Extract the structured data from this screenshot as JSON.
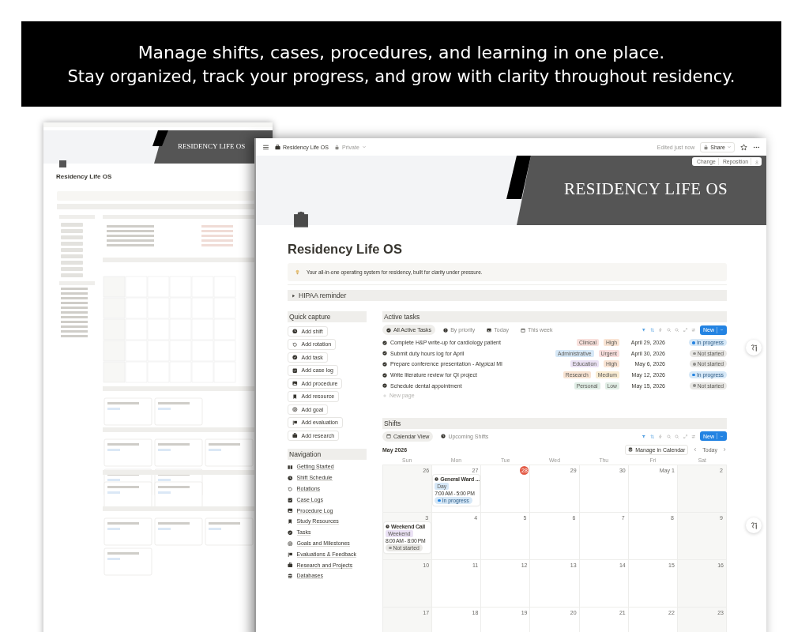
{
  "banner": {
    "lines": [
      "Manage shifts, cases, procedures, and learning in one place.",
      "Stay organized, track your progress, and grow with clarity throughout residency."
    ]
  },
  "back_window": {
    "cover_title": "RESIDENCY LIFE OS",
    "page_title": "Residency Life OS"
  },
  "window": {
    "page_name": "Residency Life OS",
    "privacy": "Private",
    "edited": "Edited just now",
    "share": "Share"
  },
  "cover": {
    "title": "RESIDENCY LIFE OS",
    "buttons": [
      "Change",
      "Reposition"
    ]
  },
  "page": {
    "title": "Residency Life OS",
    "callout": "Your all-in-one operating system for residency, built for clarity under pressure."
  },
  "toggle": {
    "label": "HIPAA reminder",
    "expanded": false
  },
  "quick_capture": {
    "title": "Quick capture",
    "buttons": [
      "Add shift",
      "Add rotation",
      "Add task",
      "Add case log",
      "Add procedure",
      "Add resource",
      "Add goal",
      "Add evaluation",
      "Add research"
    ]
  },
  "navigation": {
    "title": "Navigation",
    "items": [
      "Getting Started",
      "Shift Schedule",
      "Rotations",
      "Case Logs",
      "Procedure Log",
      "Study Resources",
      "Tasks",
      "Goals and Milestones",
      "Evaluations & Feedback",
      "Research and Projects",
      "Databases"
    ]
  },
  "active_tasks": {
    "title": "Active tasks",
    "views": [
      {
        "label": "All Active Tasks",
        "selected": true
      },
      {
        "label": "By priority",
        "selected": false
      },
      {
        "label": "Today",
        "selected": false
      },
      {
        "label": "This week",
        "selected": false
      }
    ],
    "new_button": "New",
    "rows": [
      {
        "title": "Complete H&P write-up for cardiology patient",
        "tags": [
          {
            "label": "Clinical",
            "color": "#f8e0dc"
          },
          {
            "label": "High",
            "color": "#f9e4d4"
          }
        ],
        "date": "April 29, 2026",
        "status": {
          "label": "In progress",
          "kind": "in_progress"
        }
      },
      {
        "title": "Submit duty hours log for April",
        "tags": [
          {
            "label": "Administrative",
            "color": "#d6e8f7"
          },
          {
            "label": "Urgent",
            "color": "#f9dede"
          }
        ],
        "date": "April 30, 2026",
        "status": {
          "label": "Not started",
          "kind": "not_started"
        }
      },
      {
        "title": "Prepare conference presentation - Atypical MI",
        "tags": [
          {
            "label": "Education",
            "color": "#ebe2f5"
          },
          {
            "label": "High",
            "color": "#f9e4d4"
          }
        ],
        "date": "May 6, 2026",
        "status": {
          "label": "Not started",
          "kind": "not_started"
        }
      },
      {
        "title": "Write literature review for QI project",
        "tags": [
          {
            "label": "Research",
            "color": "#f8e3d2"
          },
          {
            "label": "Medium",
            "color": "#f9ecd2"
          }
        ],
        "date": "May 12, 2026",
        "status": {
          "label": "In progress",
          "kind": "in_progress"
        }
      },
      {
        "title": "Schedule dental appointment",
        "tags": [
          {
            "label": "Personal",
            "color": "#dfede5"
          },
          {
            "label": "Low",
            "color": "#e1eee6"
          }
        ],
        "date": "May 15, 2026",
        "status": {
          "label": "Not started",
          "kind": "not_started"
        }
      }
    ],
    "new_page": "New page"
  },
  "shifts": {
    "title": "Shifts",
    "views": [
      {
        "label": "Calendar View",
        "selected": true
      },
      {
        "label": "Upcoming Shifts",
        "selected": false
      }
    ],
    "new_button": "New",
    "month": "May 2026",
    "manage": "Manage in Calendar",
    "today": "Today",
    "weekdays": [
      "Sun",
      "Mon",
      "Tue",
      "Wed",
      "Thu",
      "Fri",
      "Sat"
    ],
    "weeks": [
      {
        "days": [
          {
            "label": "26",
            "today": false
          },
          {
            "label": "27",
            "today": false,
            "event": {
              "title": "General Ward ...",
              "tag": {
                "label": "Day",
                "color": "#d6e8f7"
              },
              "time": "7:00 AM - 5:00 PM",
              "status": {
                "label": "In progress",
                "kind": "in_progress"
              }
            }
          },
          {
            "label": "28",
            "today": true
          },
          {
            "label": "29",
            "today": false
          },
          {
            "label": "30",
            "today": false
          },
          {
            "label": "May 1",
            "today": false
          },
          {
            "label": "2",
            "today": false
          }
        ]
      },
      {
        "days": [
          {
            "label": "3",
            "today": false,
            "event": {
              "title": "Weekend Call",
              "tag": {
                "label": "Weekend",
                "color": "#ebe2f5"
              },
              "time": "8:00 AM - 8:00 PM",
              "status": {
                "label": "Not started",
                "kind": "not_started"
              }
            }
          },
          {
            "label": "4",
            "today": false
          },
          {
            "label": "5",
            "today": false
          },
          {
            "label": "6",
            "today": false
          },
          {
            "label": "7",
            "today": false
          },
          {
            "label": "8",
            "today": false
          },
          {
            "label": "9",
            "today": false
          }
        ]
      },
      {
        "days": [
          {
            "label": "10",
            "today": false
          },
          {
            "label": "11",
            "today": false
          },
          {
            "label": "12",
            "today": false
          },
          {
            "label": "13",
            "today": false
          },
          {
            "label": "14",
            "today": false
          },
          {
            "label": "15",
            "today": false
          },
          {
            "label": "16",
            "today": false
          }
        ]
      },
      {
        "days": [
          {
            "label": "17",
            "today": false
          },
          {
            "label": "18",
            "today": false
          },
          {
            "label": "19",
            "today": false
          },
          {
            "label": "20",
            "today": false
          },
          {
            "label": "21",
            "today": false
          },
          {
            "label": "22",
            "today": false
          },
          {
            "label": "23",
            "today": false
          }
        ]
      }
    ]
  }
}
